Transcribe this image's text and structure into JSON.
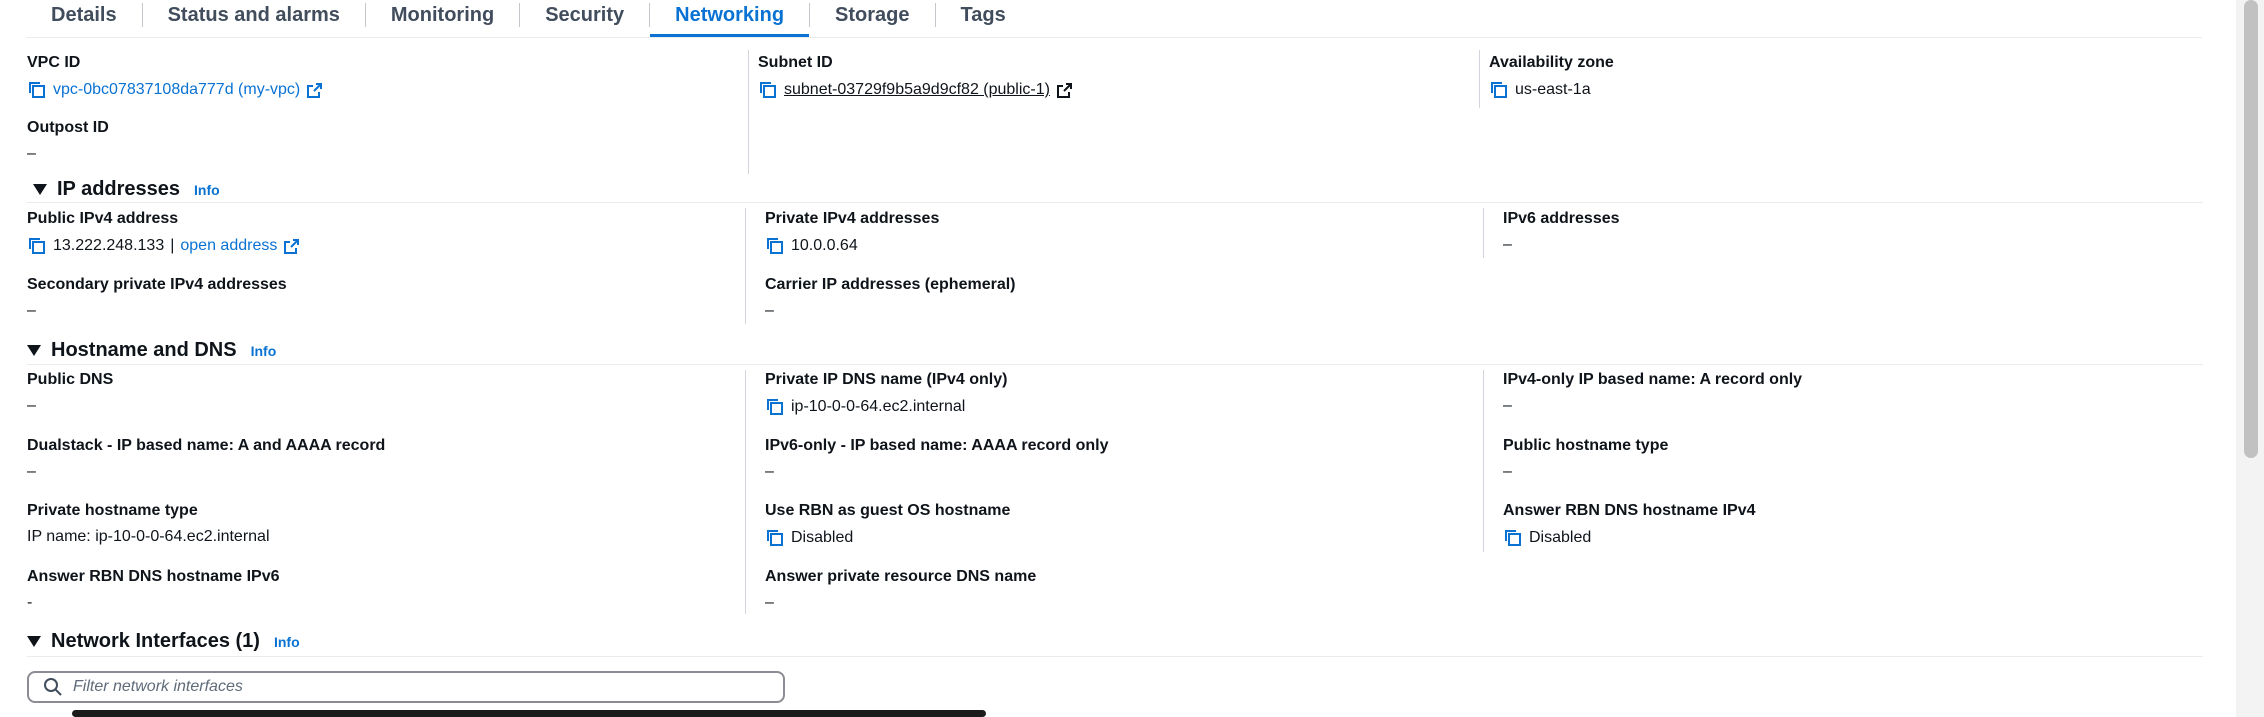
{
  "tabs": [
    {
      "label": "Details"
    },
    {
      "label": "Status and alarms"
    },
    {
      "label": "Monitoring"
    },
    {
      "label": "Security"
    },
    {
      "label": "Networking"
    },
    {
      "label": "Storage"
    },
    {
      "label": "Tags"
    }
  ],
  "active_tab": "Networking",
  "top": {
    "vpc_label": "VPC ID",
    "vpc_value": "vpc-0bc07837108da777d (my-vpc)",
    "subnet_label": "Subnet ID",
    "subnet_value": "subnet-03729f9b5a9d9cf82 (public-1)",
    "az_label": "Availability zone",
    "az_value": "us-east-1a",
    "outpost_label": "Outpost ID",
    "outpost_value": "–"
  },
  "ip": {
    "title": "IP addresses",
    "info": "Info",
    "public_label": "Public IPv4 address",
    "public_value": "13.222.248.133",
    "public_sep": "|",
    "open_address": "open address",
    "private_label": "Private IPv4 addresses",
    "private_value": "10.0.0.64",
    "ipv6_label": "IPv6 addresses",
    "ipv6_value": "–",
    "secondary_label": "Secondary private IPv4 addresses",
    "secondary_value": "–",
    "carrier_label": "Carrier IP addresses (ephemeral)",
    "carrier_value": "–"
  },
  "dns": {
    "title": "Hostname and DNS",
    "info": "Info",
    "public_dns_label": "Public DNS",
    "public_dns_value": "–",
    "private_dns_label": "Private IP DNS name (IPv4 only)",
    "private_dns_value": "ip-10-0-0-64.ec2.internal",
    "ipv4only_label": "IPv4-only IP based name: A record only",
    "ipv4only_value": "–",
    "dualstack_label": "Dualstack - IP based name: A and AAAA record",
    "dualstack_value": "–",
    "ipv6only_label": "IPv6-only - IP based name: AAAA record only",
    "ipv6only_value": "–",
    "pubhost_label": "Public hostname type",
    "pubhost_value": "–",
    "privhost_label": "Private hostname type",
    "privhost_value": "IP name: ip-10-0-0-64.ec2.internal",
    "rbn_guest_label": "Use RBN as guest OS hostname",
    "rbn_guest_value": "Disabled",
    "rbn_ipv4_label": "Answer RBN DNS hostname IPv4",
    "rbn_ipv4_value": "Disabled",
    "rbn_ipv6_label": "Answer RBN DNS hostname IPv6",
    "rbn_ipv6_value": "-",
    "private_res_label": "Answer private resource DNS name",
    "private_res_value": "–"
  },
  "ni": {
    "title": "Network Interfaces (1)",
    "info": "Info",
    "filter_placeholder": "Filter network interfaces"
  },
  "colors": {
    "accent": "#0972d3",
    "text": "#0f141a",
    "muted": "#5f6b7a"
  },
  "icons": [
    "copy-icon",
    "external-link-icon",
    "search-icon",
    "caret-down-icon"
  ]
}
